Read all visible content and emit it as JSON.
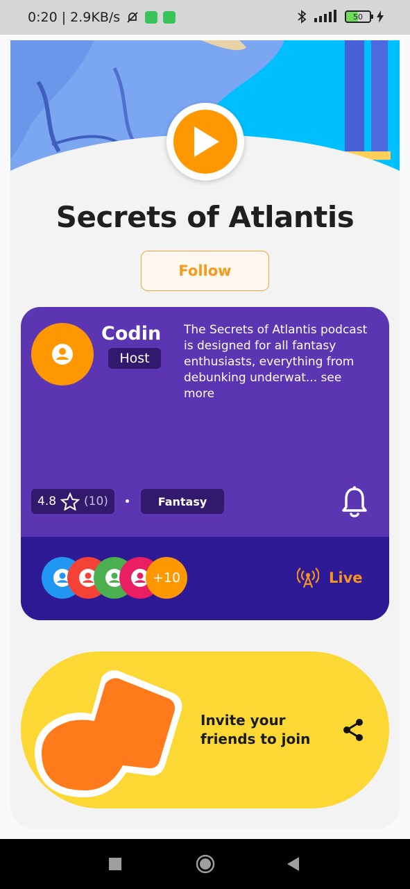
{
  "status_bar": {
    "time_speed": "0:20 | 2.9KB/s",
    "battery": "50"
  },
  "podcast": {
    "title": "Secrets of Atlantis",
    "follow_label": "Follow"
  },
  "host": {
    "name": "Codin",
    "role": "Host",
    "description": "The Secrets of Atlantis podcast is designed for all fantasy enthusiasts, everything from debunking underwat... see more",
    "rating": "4.8",
    "rating_count": "(10)",
    "genre": "Fantasy"
  },
  "listeners": {
    "more_count": "+10",
    "live_label": "Live",
    "avatar_colors": [
      "#2196f3",
      "#f44336",
      "#4caf50",
      "#e91e63",
      "#ff9800"
    ]
  },
  "invite": {
    "line1": "Invite your",
    "line2": "friends to join"
  },
  "colors": {
    "accent": "#ff9800",
    "panel": "#5c35b3",
    "live_bar": "#2f1a96",
    "invite_bg": "#fcd835"
  }
}
